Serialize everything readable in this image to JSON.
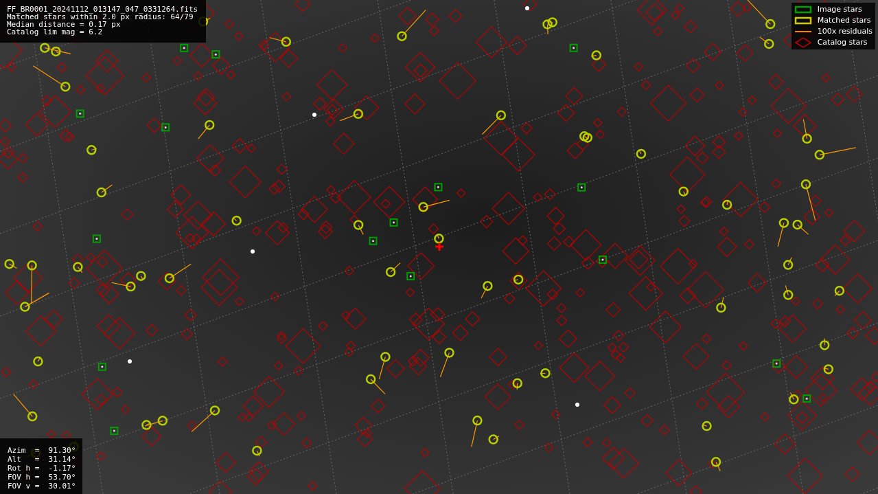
{
  "info_box": {
    "lines": [
      "FF_BR0001_20241112_013147_047_0331264.fits",
      "Matched stars within 2.0 px radius: 64/79",
      "Median distance = 0.17 px",
      "Catalog lim mag = 6.2"
    ]
  },
  "legend": [
    {
      "kind": "box",
      "color": "#00a000",
      "label": "Image stars"
    },
    {
      "kind": "box",
      "color": "#d0d000",
      "label": "Matched stars"
    },
    {
      "kind": "line",
      "color": "#ff8000",
      "label": "100x residuals"
    },
    {
      "kind": "diamond",
      "color": "#c00000",
      "label": "Catalog stars"
    }
  ],
  "pointing_box": {
    "lines": [
      "Azim  =  91.30°",
      "Alt   =  31.14°",
      "Rot h =  -1.17°",
      "FOV h =  53.70°",
      "FOV v =  30.01°"
    ]
  }
}
